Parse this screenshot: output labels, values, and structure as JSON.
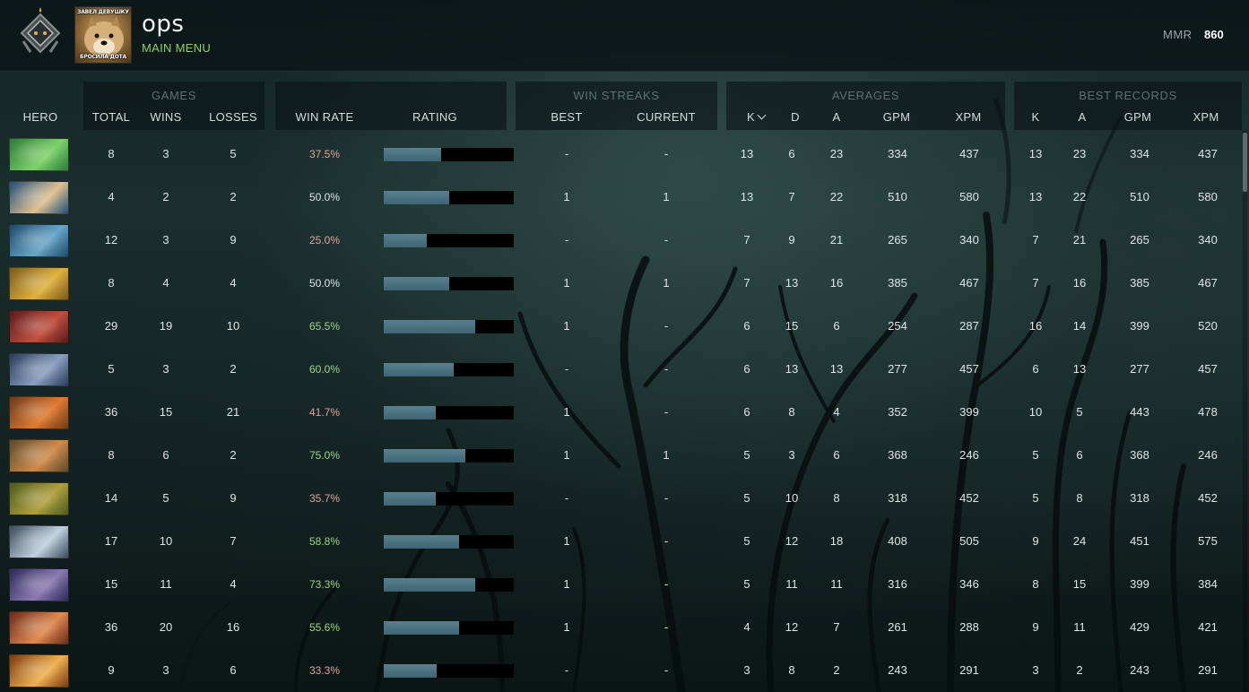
{
  "header": {
    "username": "ops",
    "main_menu": "MAIN MENU",
    "mmr_label": "MMR",
    "mmr_value": "860",
    "avatar_caption_top": "ЗАВЕЛ ДЕВУШКУ",
    "avatar_caption_bottom": "БРОСИЛА ДОТА",
    "rank_icon": "herald-rank-icon"
  },
  "groups": {
    "games": "GAMES",
    "win_streaks": "WIN STREAKS",
    "averages": "AVERAGES",
    "best_records": "BEST RECORDS"
  },
  "columns": {
    "hero": "HERO",
    "total": "TOTAL",
    "wins": "WINS",
    "losses": "LOSSES",
    "win_rate": "WIN RATE",
    "rating": "RATING",
    "best": "BEST",
    "current": "CURRENT",
    "avg_k": "K",
    "avg_d": "D",
    "avg_a": "A",
    "avg_gpm": "GPM",
    "avg_xpm": "XPM",
    "rec_k": "K",
    "rec_a": "A",
    "rec_gpm": "GPM",
    "rec_xpm": "XPM"
  },
  "colors": {
    "win_rate_high": "#9fd28a",
    "win_rate_low": "#e0a49e",
    "accent_green": "#8fcf6a"
  },
  "rows": [
    {
      "hero_color": [
        "#2f7a3a",
        "#7ed16a"
      ],
      "total": "8",
      "wins": "3",
      "losses": "5",
      "win_rate": "37.5%",
      "rating": 0.44,
      "best": "-",
      "current": "-",
      "k": "13",
      "d": "6",
      "a": "23",
      "gpm": "334",
      "xpm": "437",
      "rk": "13",
      "ra": "23",
      "rgpm": "334",
      "rxpm": "437"
    },
    {
      "hero_color": [
        "#1f4f7a",
        "#e0c090"
      ],
      "total": "4",
      "wins": "2",
      "losses": "2",
      "win_rate": "50.0%",
      "rating": 0.5,
      "best": "1",
      "current": "1",
      "k": "13",
      "d": "7",
      "a": "22",
      "gpm": "510",
      "xpm": "580",
      "rk": "13",
      "ra": "22",
      "rgpm": "510",
      "rxpm": "580"
    },
    {
      "hero_color": [
        "#1e4a6a",
        "#6aa6c8"
      ],
      "total": "12",
      "wins": "3",
      "losses": "9",
      "win_rate": "25.0%",
      "rating": 0.33,
      "best": "-",
      "current": "-",
      "k": "7",
      "d": "9",
      "a": "21",
      "gpm": "265",
      "xpm": "340",
      "rk": "7",
      "ra": "21",
      "rgpm": "265",
      "rxpm": "340"
    },
    {
      "hero_color": [
        "#7a5a1a",
        "#e0b040"
      ],
      "total": "8",
      "wins": "4",
      "losses": "4",
      "win_rate": "50.0%",
      "rating": 0.5,
      "best": "1",
      "current": "1",
      "k": "7",
      "d": "13",
      "a": "16",
      "gpm": "385",
      "xpm": "467",
      "rk": "7",
      "ra": "16",
      "rgpm": "385",
      "rxpm": "467"
    },
    {
      "hero_color": [
        "#5a1a1a",
        "#c05040"
      ],
      "total": "29",
      "wins": "19",
      "losses": "10",
      "win_rate": "65.5%",
      "rating": 0.7,
      "best": "1",
      "current": "-",
      "k": "6",
      "d": "15",
      "a": "6",
      "gpm": "254",
      "xpm": "287",
      "rk": "16",
      "ra": "14",
      "rgpm": "399",
      "rxpm": "520"
    },
    {
      "hero_color": [
        "#2a3a5a",
        "#8aa0c0"
      ],
      "total": "5",
      "wins": "3",
      "losses": "2",
      "win_rate": "60.0%",
      "rating": 0.54,
      "best": "-",
      "current": "-",
      "k": "6",
      "d": "13",
      "a": "13",
      "gpm": "277",
      "xpm": "457",
      "rk": "6",
      "ra": "13",
      "rgpm": "277",
      "rxpm": "457"
    },
    {
      "hero_color": [
        "#6a3a1a",
        "#e07a30"
      ],
      "total": "36",
      "wins": "15",
      "losses": "21",
      "win_rate": "41.7%",
      "rating": 0.4,
      "best": "1",
      "current": "-",
      "k": "6",
      "d": "8",
      "a": "4",
      "gpm": "352",
      "xpm": "399",
      "rk": "10",
      "ra": "5",
      "rgpm": "443",
      "rxpm": "478"
    },
    {
      "hero_color": [
        "#5a4a2a",
        "#d08a4a"
      ],
      "total": "8",
      "wins": "6",
      "losses": "2",
      "win_rate": "75.0%",
      "rating": 0.63,
      "best": "1",
      "current": "1",
      "k": "5",
      "d": "3",
      "a": "6",
      "gpm": "368",
      "xpm": "246",
      "rk": "5",
      "ra": "6",
      "rgpm": "368",
      "rxpm": "246"
    },
    {
      "hero_color": [
        "#4a5a1a",
        "#b0a040"
      ],
      "total": "14",
      "wins": "5",
      "losses": "9",
      "win_rate": "35.7%",
      "rating": 0.4,
      "best": "-",
      "current": "-",
      "k": "5",
      "d": "10",
      "a": "8",
      "gpm": "318",
      "xpm": "452",
      "rk": "5",
      "ra": "8",
      "rgpm": "318",
      "rxpm": "452"
    },
    {
      "hero_color": [
        "#3a4a5a",
        "#c0d0e0"
      ],
      "total": "17",
      "wins": "10",
      "losses": "7",
      "win_rate": "58.8%",
      "rating": 0.58,
      "best": "1",
      "current": "-",
      "k": "5",
      "d": "12",
      "a": "18",
      "gpm": "408",
      "xpm": "505",
      "rk": "9",
      "ra": "24",
      "rgpm": "451",
      "rxpm": "575"
    },
    {
      "hero_color": [
        "#2a2a5a",
        "#8a7ab0"
      ],
      "total": "15",
      "wins": "11",
      "losses": "4",
      "win_rate": "73.3%",
      "rating": 0.7,
      "best": "1",
      "current": "-",
      "k": "5",
      "d": "11",
      "a": "11",
      "gpm": "316",
      "xpm": "346",
      "rk": "8",
      "ra": "15",
      "rgpm": "399",
      "rxpm": "384"
    },
    {
      "hero_color": [
        "#6a2a1a",
        "#e08a50"
      ],
      "total": "36",
      "wins": "20",
      "losses": "16",
      "win_rate": "55.6%",
      "rating": 0.58,
      "best": "1",
      "current": "-",
      "k": "4",
      "d": "12",
      "a": "7",
      "gpm": "261",
      "xpm": "288",
      "rk": "9",
      "ra": "11",
      "rgpm": "429",
      "rxpm": "421"
    },
    {
      "hero_color": [
        "#7a3a10",
        "#f0b050"
      ],
      "total": "9",
      "wins": "3",
      "losses": "6",
      "win_rate": "33.3%",
      "rating": 0.41,
      "best": "-",
      "current": "-",
      "k": "3",
      "d": "8",
      "a": "2",
      "gpm": "243",
      "xpm": "291",
      "rk": "3",
      "ra": "2",
      "rgpm": "243",
      "rxpm": "291"
    }
  ]
}
